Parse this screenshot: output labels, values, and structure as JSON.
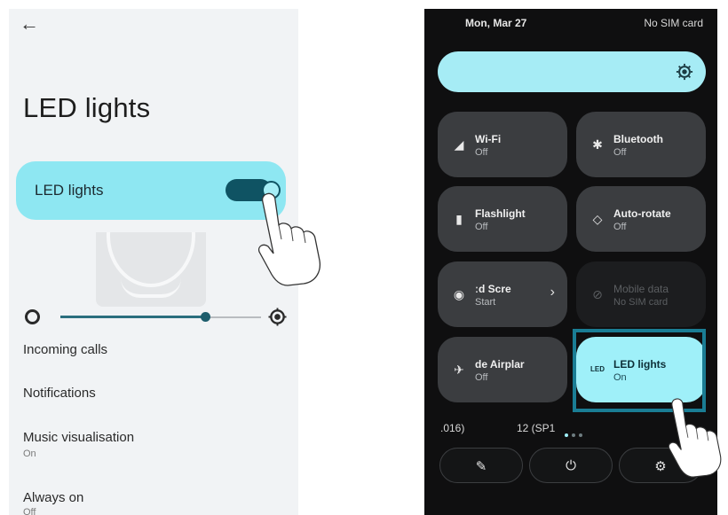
{
  "settings": {
    "back_icon": "back-arrow-icon",
    "title": "LED lights",
    "toggle_card": {
      "label": "LED lights",
      "toggle_on": true
    },
    "brightness": {
      "level_fraction": 0.72
    },
    "menu": [
      {
        "label": "Incoming calls"
      },
      {
        "label": "Notifications"
      },
      {
        "label": "Music visualisation",
        "sub": "On"
      },
      {
        "label": "Always on",
        "sub": "Off"
      }
    ]
  },
  "quick_settings": {
    "date": "Mon, Mar 27",
    "sim_status": "No SIM card",
    "tiles": [
      {
        "label": "Wi-Fi",
        "state": "Off",
        "icon": "wifi-icon"
      },
      {
        "label": "Bluetooth",
        "state": "Off",
        "icon": "bluetooth-icon"
      },
      {
        "label": "Flashlight",
        "state": "Off",
        "icon": "flashlight-icon"
      },
      {
        "label": "Auto-rotate",
        "state": "Off",
        "icon": "auto-rotate-icon"
      },
      {
        "label": "ːd Scre",
        "state": "Start",
        "icon": "screen-record-icon"
      },
      {
        "label": "Mobile data",
        "state": "No SIM card",
        "icon": "mobile-data-off-icon"
      },
      {
        "label": "de Airplar",
        "state": "Off",
        "icon": "airplane-icon"
      },
      {
        "label": "LED lights",
        "state": "On",
        "icon_text": "LED"
      }
    ],
    "build_left": ".016)",
    "build_mid": "12 (SP1",
    "page_indicator_count": 3,
    "accent_color": "#9ff0f9"
  }
}
